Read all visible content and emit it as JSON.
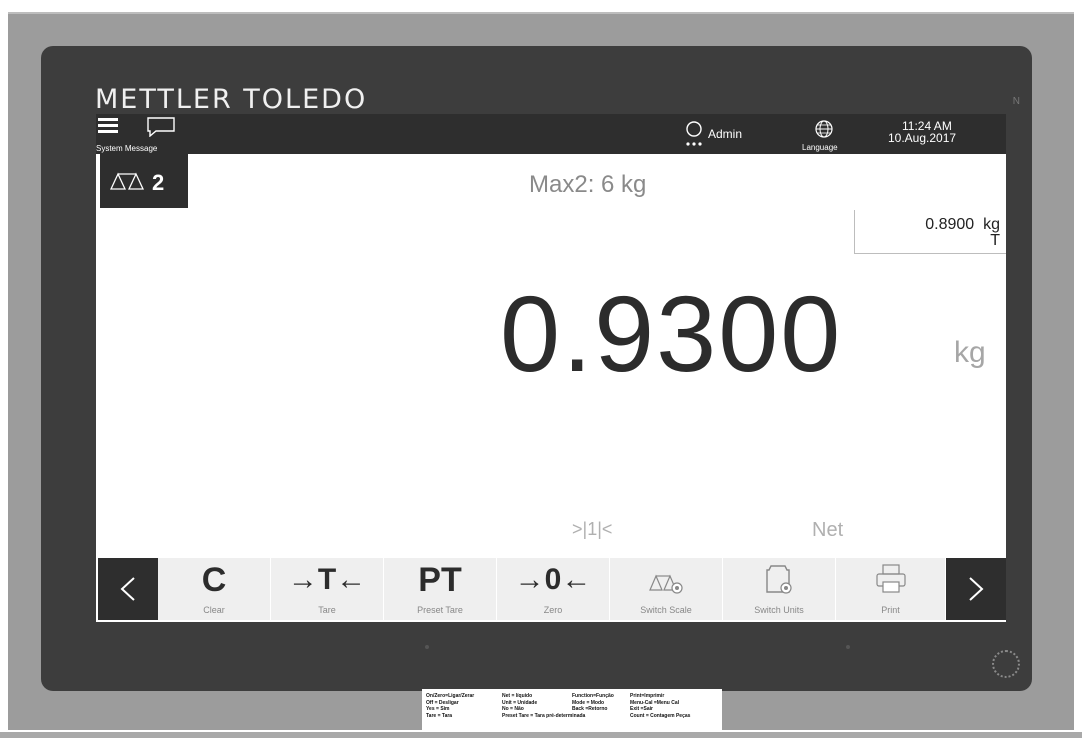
{
  "brand": "METTLER TOLEDO",
  "model_tag": "N",
  "topbar": {
    "system_message_label": "System Message",
    "user_label": "Admin",
    "language_label": "Language",
    "time": "11:24 AM",
    "date": "10.Aug.2017"
  },
  "scale": {
    "number": "2",
    "max_text": "Max2: 6 kg",
    "tare_value": "0.8900  kg",
    "tare_mark": "T",
    "weight": "0.9300",
    "weight_unit": "kg",
    "center_zero": ">|1|<",
    "net": "Net"
  },
  "softkeys": [
    {
      "symbol": "C",
      "label": "Clear"
    },
    {
      "symbol": "→T←",
      "label": "Tare"
    },
    {
      "symbol": "PT",
      "label": "Preset Tare"
    },
    {
      "symbol": "→0←",
      "label": "Zero"
    },
    {
      "symbol": "",
      "label": "Switch Scale",
      "icon": "switch-scale-icon"
    },
    {
      "symbol": "",
      "label": "Switch Units",
      "icon": "switch-units-icon"
    },
    {
      "symbol": "",
      "label": "Print",
      "icon": "printer-icon"
    }
  ],
  "legend": {
    "col1": [
      "On/Zero=Ligar/Zerar",
      "Off = Desligar",
      "Yes = Sim",
      "Tare = Tara"
    ],
    "col2": [
      "Net = líquido",
      "Unit = Unidade",
      "No = Não",
      "Preset Tare = Tara pré-determinada"
    ],
    "col3": [
      "Function=Função",
      "Mode = Modo",
      "Back =Retorno",
      ""
    ],
    "col4": [
      "Print=Imprimir",
      "Menu-Cal =Menu Cal",
      "Exit =Sair",
      "Count = Contagem Peças"
    ]
  },
  "colors": {
    "topbar": "#2e2e2e",
    "bezel": "#3d3d3d",
    "key_bg": "#efefef"
  }
}
